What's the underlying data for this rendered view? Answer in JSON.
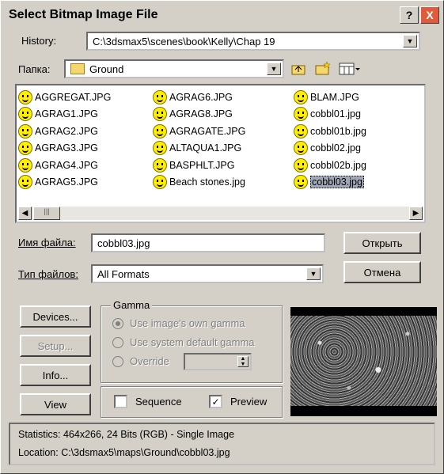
{
  "title": "Select Bitmap Image File",
  "titlebar_buttons": {
    "help": "?",
    "close": "X"
  },
  "history": {
    "label": "History:",
    "value": "C:\\3dsmax5\\scenes\\book\\Kelly\\Chap 19"
  },
  "folder": {
    "label": "Папка:",
    "value": "Ground"
  },
  "files": [
    [
      {
        "name": "AGGREGAT.JPG"
      },
      {
        "name": "AGRAG1.JPG"
      },
      {
        "name": "AGRAG2.JPG"
      },
      {
        "name": "AGRAG3.JPG"
      },
      {
        "name": "AGRAG4.JPG"
      },
      {
        "name": "AGRAG5.JPG"
      }
    ],
    [
      {
        "name": "AGRAG6.JPG"
      },
      {
        "name": "AGRAG8.JPG"
      },
      {
        "name": "AGRAGATE.JPG"
      },
      {
        "name": "ALTAQUA1.JPG"
      },
      {
        "name": "BASPHLT.JPG"
      },
      {
        "name": "Beach stones.jpg"
      }
    ],
    [
      {
        "name": "BLAM.JPG"
      },
      {
        "name": "cobbl01.jpg"
      },
      {
        "name": "cobbl01b.jpg"
      },
      {
        "name": "cobbl02.jpg"
      },
      {
        "name": "cobbl02b.jpg"
      },
      {
        "name": "cobbl03.jpg",
        "selected": true
      }
    ]
  ],
  "filename": {
    "label": "Имя файла:",
    "value": "cobbl03.jpg"
  },
  "filetype": {
    "label": "Тип файлов:",
    "value": "All Formats"
  },
  "buttons": {
    "open": "Открыть",
    "cancel": "Отмена",
    "devices": "Devices...",
    "setup": "Setup...",
    "info": "Info...",
    "view": "View"
  },
  "gamma": {
    "title": "Gamma",
    "own": "Use image's own gamma",
    "system": "Use system default gamma",
    "override": "Override",
    "selected": "own"
  },
  "sequence": {
    "label": "Sequence",
    "checked": false
  },
  "preview": {
    "label": "Preview",
    "checked": true
  },
  "status": {
    "statistics": "Statistics:  464x266, 24 Bits (RGB) - Single Image",
    "location": "Location:  C:\\3dsmax5\\maps\\Ground\\cobbl03.jpg"
  }
}
